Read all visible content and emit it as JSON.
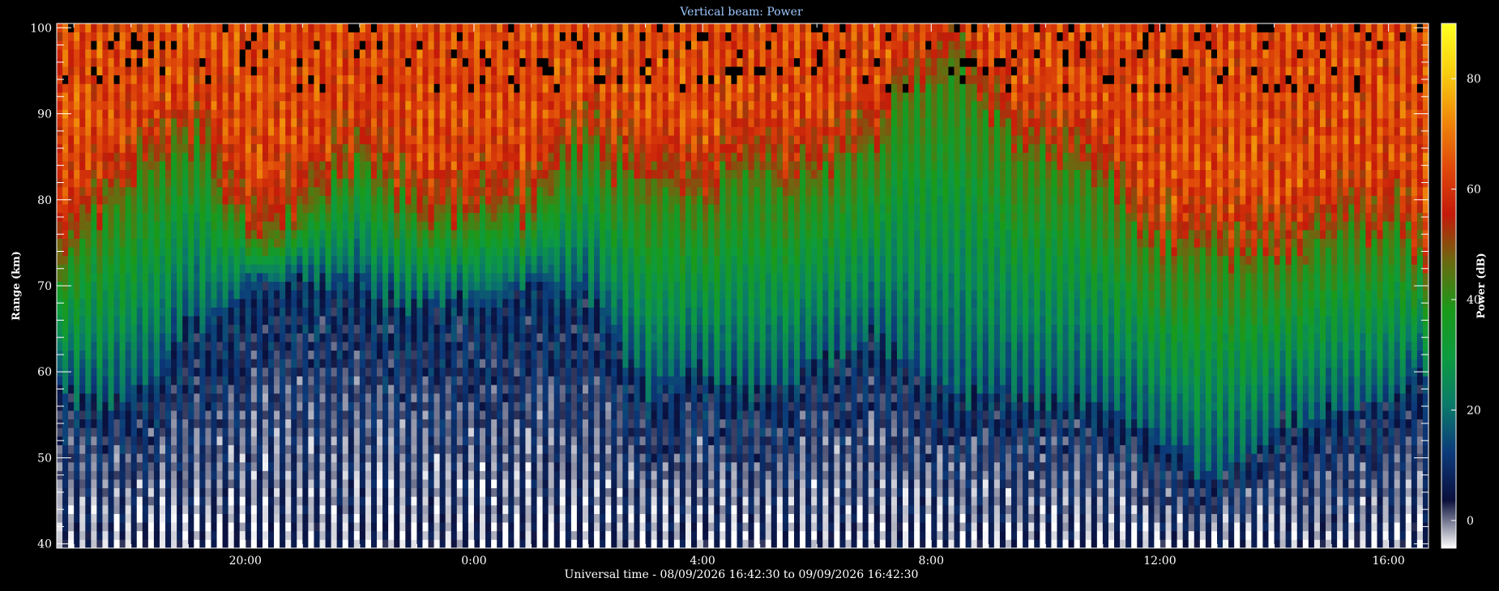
{
  "chart_data": {
    "type": "heatmap",
    "title": "Vertical beam: Power",
    "xlabel": "Universal time - 08/09/2026 16:42:30 to 09/09/2026 16:42:30",
    "ylabel": "Range (km)",
    "x_range_hours": [
      16.7,
      40.7
    ],
    "y_range_km": [
      39.5,
      100.5
    ],
    "x_ticks": [
      {
        "value": 20,
        "label": "20:00"
      },
      {
        "value": 24,
        "label": "0:00"
      },
      {
        "value": 28,
        "label": "4:00"
      },
      {
        "value": 32,
        "label": "8:00"
      },
      {
        "value": 36,
        "label": "12:00"
      },
      {
        "value": 40,
        "label": "16:00"
      }
    ],
    "y_ticks": [
      40,
      50,
      60,
      70,
      80,
      90,
      100
    ],
    "colorbar": {
      "label": "Power (dB)",
      "range": [
        -5,
        90
      ],
      "ticks": [
        0,
        20,
        40,
        60,
        80
      ],
      "colors": [
        "#ffffff",
        "#0a0f3c",
        "#0c3a7a",
        "#0b7a6a",
        "#0d9b40",
        "#1a9a1a",
        "#6a6a10",
        "#c41a0a",
        "#e04a0a",
        "#f08a0a",
        "#f8d010",
        "#ffff20"
      ]
    },
    "time_step_hours": 0.1,
    "profile_knots_hours": [
      16.7,
      17.5,
      18.5,
      19.0,
      19.5,
      20.2,
      21.0,
      22.0,
      23.0,
      24.0,
      25.0,
      26.0,
      27.0,
      28.0,
      29.0,
      30.0,
      31.0,
      32.0,
      32.5,
      33.0,
      34.0,
      35.0,
      36.0,
      37.0,
      38.0,
      39.0,
      40.0,
      40.7
    ],
    "lower_boundary_km": [
      58,
      56,
      61,
      65,
      66,
      71,
      71,
      70,
      67,
      68,
      71,
      69,
      58,
      60,
      58,
      61,
      64,
      59,
      57,
      57,
      57,
      57,
      52,
      47,
      54,
      55,
      57,
      60
    ],
    "upper_boundary_km": [
      71,
      79,
      84,
      87,
      82,
      75,
      79,
      85,
      78,
      77,
      79,
      86,
      81,
      81,
      83,
      82,
      87,
      95,
      96,
      90,
      84,
      83,
      74,
      73,
      73,
      75,
      76,
      73
    ],
    "notes_gaps": "Black (no data) columns and cells near the top edge."
  }
}
